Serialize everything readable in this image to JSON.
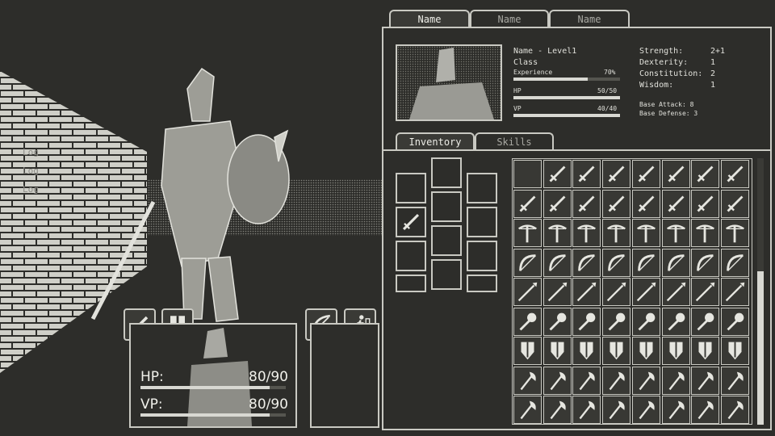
{
  "top_tabs": [
    "Name",
    "Name",
    "Name"
  ],
  "character": {
    "name_level": "Name - Level1",
    "class_label": "Class",
    "experience_label": "Experience",
    "experience_value": "70%",
    "experience_fraction": 0.7,
    "hp_label": "HP",
    "hp_value": "50/50",
    "vp_label": "VP",
    "vp_value": "40/40",
    "stats": [
      {
        "label": "Strength:",
        "value": "2+1"
      },
      {
        "label": "Dexterity:",
        "value": "1"
      },
      {
        "label": "Constitution:",
        "value": "2"
      },
      {
        "label": "Wisdom:",
        "value": "1"
      }
    ],
    "base_attack": "Base Attack: 8",
    "base_defense": "Base Defense: 3"
  },
  "sub_tabs": [
    "Inventory",
    "Skills"
  ],
  "hud": {
    "hp_label": "HP:",
    "hp_value": "80/90",
    "hp_fraction": 0.89,
    "vp_label": "VP:",
    "vp_value": "80/90",
    "vp_fraction": 0.89
  },
  "log_text": [
    "Log",
    "Log",
    "Log"
  ],
  "inventory_rows": [
    [
      "empty",
      "sword",
      "sword",
      "sword",
      "sword",
      "sword",
      "sword",
      "sword"
    ],
    [
      "sword",
      "sword",
      "sword",
      "sword",
      "sword",
      "sword",
      "sword",
      "sword"
    ],
    [
      "crossbow",
      "crossbow",
      "crossbow",
      "crossbow",
      "crossbow",
      "crossbow",
      "crossbow",
      "crossbow"
    ],
    [
      "bow",
      "bow",
      "bow",
      "bow",
      "bow",
      "bow",
      "bow",
      "bow"
    ],
    [
      "spear",
      "spear",
      "spear",
      "spear",
      "spear",
      "spear",
      "spear",
      "spear"
    ],
    [
      "mace",
      "mace",
      "mace",
      "mace",
      "mace",
      "mace",
      "mace",
      "mace"
    ],
    [
      "shield",
      "shield",
      "shield",
      "shield",
      "shield",
      "shield",
      "shield",
      "shield"
    ],
    [
      "axe",
      "axe",
      "axe",
      "axe",
      "axe",
      "axe",
      "axe",
      "axe"
    ],
    [
      "axe",
      "axe",
      "axe",
      "axe",
      "axe",
      "axe",
      "axe",
      "axe"
    ]
  ]
}
